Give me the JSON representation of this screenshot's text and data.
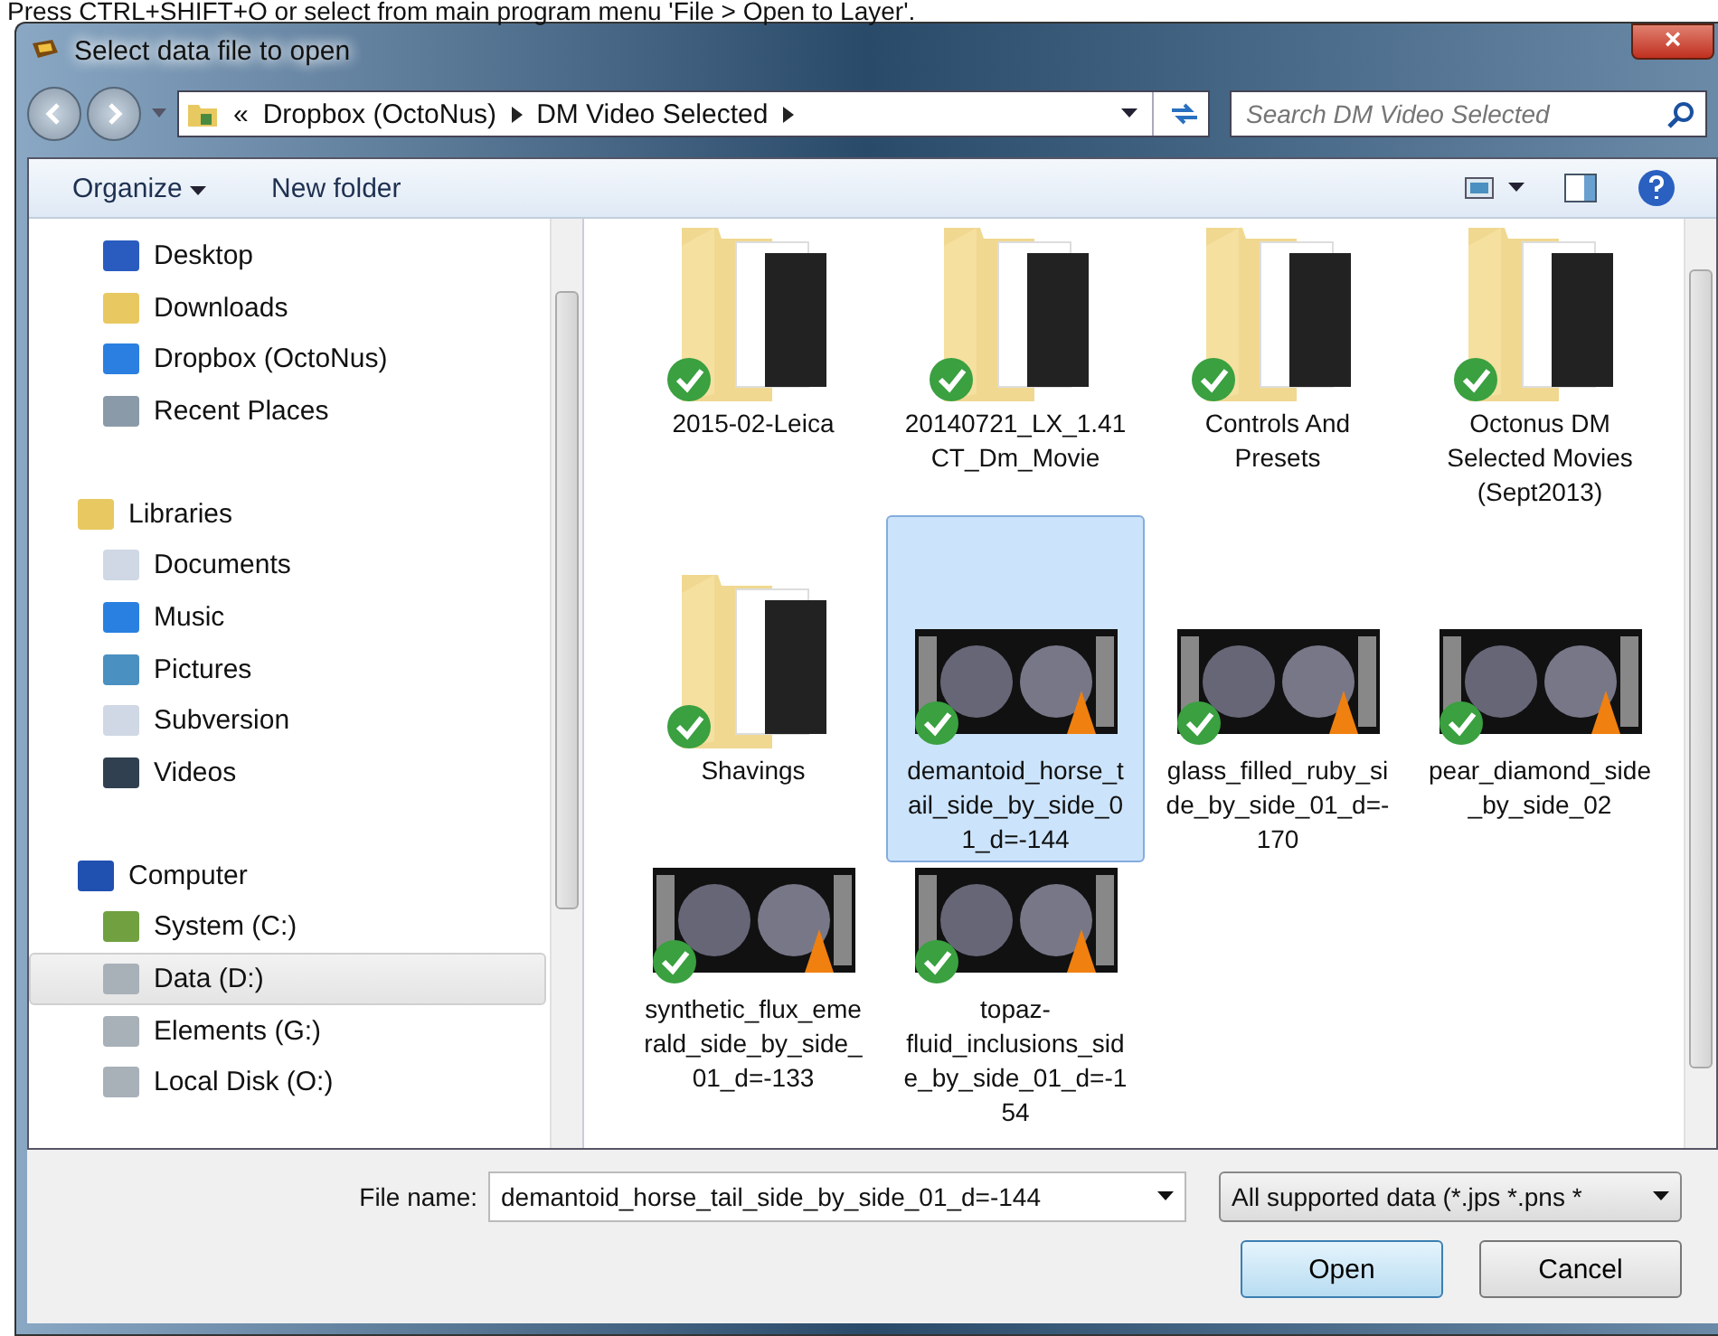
{
  "hint": "Press CTRL+SHIFT+O or select from main program menu 'File > Open to Layer'.",
  "window": {
    "title": "Select data file to open",
    "close": "×"
  },
  "address": {
    "crumbs": [
      "Dropbox (OctoNus)",
      "DM Video Selected"
    ],
    "overflow": "«"
  },
  "search": {
    "placeholder": "Search DM Video Selected"
  },
  "toolbar": {
    "organize": "Organize",
    "new_folder": "New folder"
  },
  "favorites": [
    {
      "label": "Desktop",
      "kind": "desktop",
      "selected": false
    },
    {
      "label": "Downloads",
      "kind": "downloads",
      "selected": false
    },
    {
      "label": "Dropbox (OctoNus)",
      "kind": "dropbox",
      "selected": false
    },
    {
      "label": "Recent Places",
      "kind": "recent",
      "selected": false
    }
  ],
  "groups": [
    {
      "label": "Libraries",
      "kind": "libraries",
      "children": [
        {
          "label": "Documents",
          "kind": "document",
          "selected": false
        },
        {
          "label": "Music",
          "kind": "music",
          "selected": false
        },
        {
          "label": "Pictures",
          "kind": "pictures",
          "selected": false
        },
        {
          "label": "Subversion",
          "kind": "document",
          "selected": false
        },
        {
          "label": "Videos",
          "kind": "videos",
          "selected": false
        }
      ]
    },
    {
      "label": "Computer",
      "kind": "computer",
      "children": [
        {
          "label": "System (C:)",
          "kind": "system-drive",
          "selected": false
        },
        {
          "label": "Data (D:)",
          "kind": "drive",
          "selected": true
        },
        {
          "label": "Elements (G:)",
          "kind": "drive",
          "selected": false
        },
        {
          "label": "Local Disk (O:)",
          "kind": "drive",
          "selected": false
        }
      ]
    }
  ],
  "files": [
    {
      "name": "2015-02-Leica",
      "kind": "folder",
      "selected": false
    },
    {
      "name": "20140721_LX_1.41 CT_Dm_Movie",
      "kind": "folder",
      "selected": false
    },
    {
      "name": "Controls And Presets",
      "kind": "folder",
      "selected": false
    },
    {
      "name": "Octonus DM Selected Movies (Sept2013)",
      "kind": "folder",
      "selected": false
    },
    {
      "name": "Shavings",
      "kind": "folder",
      "selected": false
    },
    {
      "name": "demantoid_horse_tail_side_by_side_01_d=-144",
      "kind": "video",
      "selected": true
    },
    {
      "name": "glass_filled_ruby_side_by_side_01_d=-170",
      "kind": "video",
      "selected": false
    },
    {
      "name": "pear_diamond_side_by_side_02",
      "kind": "video",
      "selected": false
    },
    {
      "name": "synthetic_flux_emerald_side_by_side_01_d=-133",
      "kind": "video",
      "selected": false
    },
    {
      "name": "topaz-fluid_inclusions_side_by_side_01_d=-154",
      "kind": "video",
      "selected": false
    }
  ],
  "footer": {
    "file_name_label": "File name:",
    "file_name": "demantoid_horse_tail_side_by_side_01_d=-144",
    "filter": "All supported data (*.jps *.pns *",
    "open": "Open",
    "cancel": "Cancel"
  }
}
